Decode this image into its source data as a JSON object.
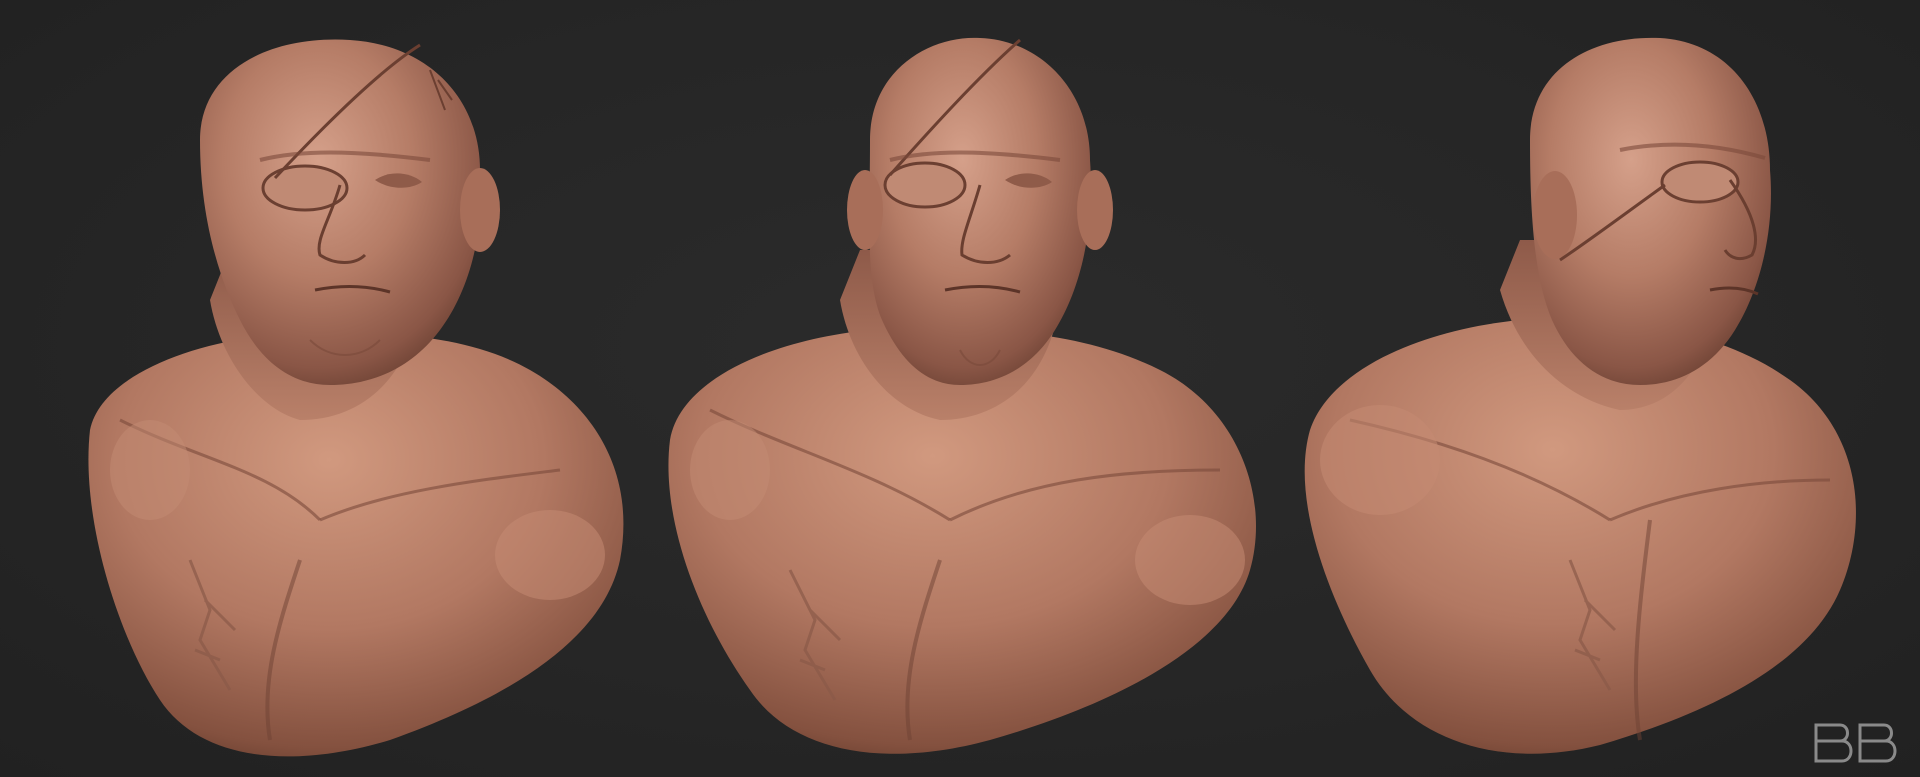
{
  "scene": {
    "background_color": "#252525",
    "clay_base_color": "#b7806b",
    "clay_highlight_color": "#d7a38c",
    "clay_shadow_color": "#5d382c",
    "views": [
      {
        "id": "front-left",
        "description_icon": "sculpt-bust-front-left"
      },
      {
        "id": "front",
        "description_icon": "sculpt-bust-front"
      },
      {
        "id": "three-quarter-right",
        "description_icon": "sculpt-bust-three-quarter"
      }
    ]
  },
  "watermark": {
    "text": "BB",
    "color": "#8a8a8a"
  }
}
